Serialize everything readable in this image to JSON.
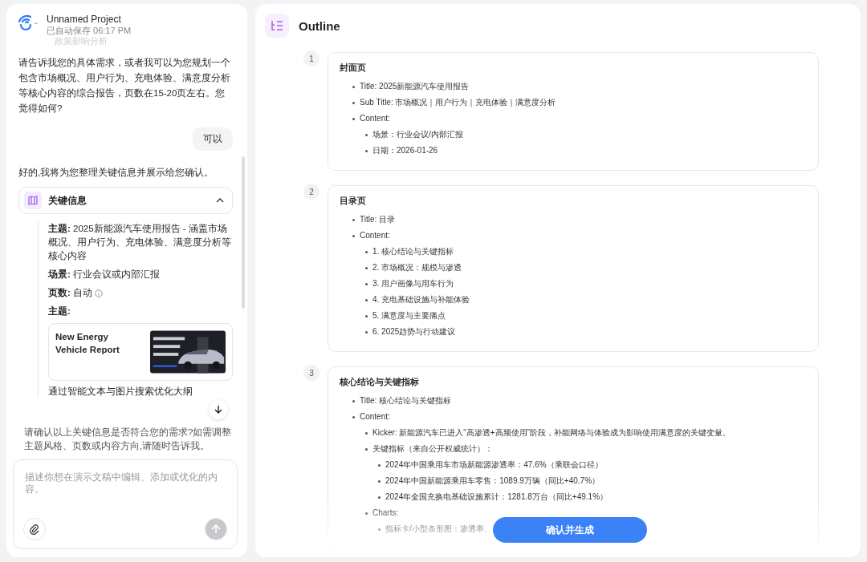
{
  "project": {
    "name": "Unnamed Project",
    "saved": "已自动保存 06:17 PM"
  },
  "chat": {
    "faded_top": "政策影响分析",
    "messages": [
      {
        "kind": "assistant",
        "text": "请告诉我您的具体需求，或者我可以为您规划一个包含市场概况、用户行为、充电体验、满意度分析等核心内容的综合报告，页数在15-20页左右。您觉得如何?"
      },
      {
        "kind": "user",
        "text": "可以"
      },
      {
        "kind": "assistant",
        "text": "好的,我将为您整理关键信息并展示给您确认。"
      }
    ],
    "key_info": {
      "title": "关键信息",
      "expanded": true,
      "fields": [
        {
          "label": "主题:",
          "value": "2025新能源汽车使用报告 - 涵盖市场概况、用户行为、充电体验、满意度分析等核心内容"
        },
        {
          "label": "场景:",
          "value": "行业会议或内部汇报"
        },
        {
          "label": "页数:",
          "value": "自动"
        },
        {
          "label": "主题:"
        }
      ],
      "theme_card": {
        "name": "New Energy Vehicle Report"
      },
      "note": "通过智能文本与图片搜索优化大纲"
    },
    "closing": "请确认以上关键信息是否符合您的需求?如需调整主题风格、页数或内容方向,请随时告诉我。",
    "input": {
      "placeholder": "描述你想在演示文稿中编辑、添加或优化的内容。"
    }
  },
  "outline": {
    "title": "Outline",
    "slides": [
      {
        "number": "1",
        "heading": "封面页",
        "items": [
          {
            "text": "Title: 2025新能源汽车使用报告"
          },
          {
            "text": "Sub Title: 市场概况｜用户行为｜充电体验｜满意度分析"
          },
          {
            "text": "Content:",
            "children": [
              {
                "text": "场景：行业会议/内部汇报"
              },
              {
                "text": "日期：2026-01-26"
              }
            ]
          }
        ]
      },
      {
        "number": "2",
        "heading": "目录页",
        "items": [
          {
            "text": "Title: 目录"
          },
          {
            "text": "Content:",
            "children": [
              {
                "text": "1. 核心结论与关键指标"
              },
              {
                "text": "2. 市场概况：规模与渗透"
              },
              {
                "text": "3. 用户画像与用车行为"
              },
              {
                "text": "4. 充电基础设施与补能体验"
              },
              {
                "text": "5. 满意度与主要痛点"
              },
              {
                "text": "6. 2025趋势与行动建议"
              }
            ]
          }
        ]
      },
      {
        "number": "3",
        "heading": "核心结论与关键指标",
        "items": [
          {
            "text": "Title: 核心结论与关键指标"
          },
          {
            "text": "Content:",
            "children": [
              {
                "text": "Kicker: 新能源汽车已进入“高渗透+高频使用”阶段，补能网络与体验成为影响使用满意度的关键变量。"
              },
              {
                "text": "关键指标（来自公开权威统计）：",
                "children": [
                  {
                    "text": "2024年中国乘用车市场新能源渗透率：47.6%（乘联会口径）"
                  },
                  {
                    "text": "2024年中国新能源乘用车零售：1089.9万辆（同比+40.7%）"
                  },
                  {
                    "text": "2024年全国充换电基础设施累计：1281.8万台（同比+49.1%）"
                  }
                ]
              },
              {
                "text": "Charts:",
                "children": [
                  {
                    "text": "指标卡/小型条形图：渗透率、"
                  }
                ]
              }
            ]
          }
        ]
      }
    ],
    "confirm_button": "确认并生成"
  }
}
